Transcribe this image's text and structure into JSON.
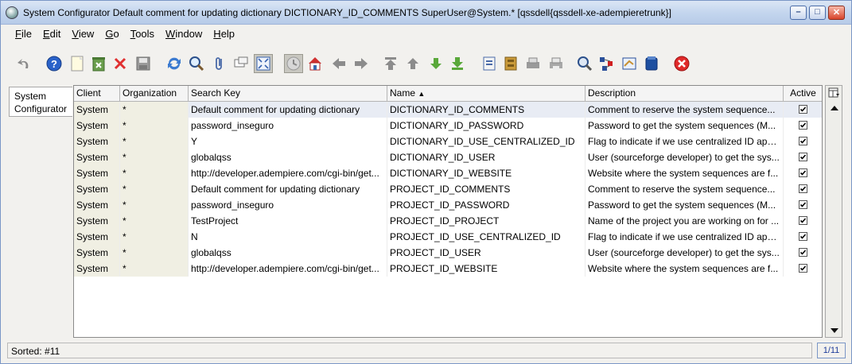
{
  "window": {
    "title": "System Configurator  Default comment for updating dictionary  DICTIONARY_ID_COMMENTS  SuperUser@System.* [qssdell{qssdell-xe-adempieretrunk}]",
    "min_glyph": "–",
    "max_glyph": "□",
    "close_glyph": "✕"
  },
  "menu": [
    {
      "pre": "",
      "u": "F",
      "post": "ile"
    },
    {
      "pre": "",
      "u": "E",
      "post": "dit"
    },
    {
      "pre": "",
      "u": "V",
      "post": "iew"
    },
    {
      "pre": "",
      "u": "G",
      "post": "o"
    },
    {
      "pre": "",
      "u": "T",
      "post": "ools"
    },
    {
      "pre": "",
      "u": "W",
      "post": "indow"
    },
    {
      "pre": "",
      "u": "H",
      "post": "elp"
    }
  ],
  "toolbar_icons": [
    "undo-icon",
    "help-icon",
    "new-record-icon",
    "delete-record-icon",
    "delete-icon",
    "save-icon",
    "refresh-icon",
    "find-icon",
    "attachment-icon",
    "chat-icon",
    "grid-toggle-icon",
    "history-icon",
    "home-icon",
    "previous-record-icon",
    "next-record-icon",
    "first-record-icon",
    "parent-record-icon",
    "detail-record-icon",
    "last-record-icon",
    "report-icon",
    "archive-icon",
    "print-icon",
    "print-preview-icon",
    "zoom-across-icon",
    "active-workflows-icon",
    "requests-icon",
    "product-info-icon",
    "exit-icon"
  ],
  "side_tab": {
    "line1": "System",
    "line2": "Configurator"
  },
  "grid": {
    "columns": [
      {
        "label": "Client"
      },
      {
        "label": "Organization"
      },
      {
        "label": "Search Key"
      },
      {
        "label": "Name",
        "sort": "▲"
      },
      {
        "label": "Description"
      },
      {
        "label": "Active"
      }
    ],
    "rows": [
      {
        "client": "System",
        "org": "*",
        "key": "Default comment for updating dictionary",
        "name": "DICTIONARY_ID_COMMENTS",
        "desc": "Comment to reserve the system sequence...",
        "active": true
      },
      {
        "client": "System",
        "org": "*",
        "key": "password_inseguro",
        "name": "DICTIONARY_ID_PASSWORD",
        "desc": "Password to get the system sequences (M...",
        "active": true
      },
      {
        "client": "System",
        "org": "*",
        "key": "Y",
        "name": "DICTIONARY_ID_USE_CENTRALIZED_ID",
        "desc": "Flag to indicate if we use centralized ID app...",
        "active": true
      },
      {
        "client": "System",
        "org": "*",
        "key": "globalqss",
        "name": "DICTIONARY_ID_USER",
        "desc": "User (sourceforge developer) to get the sys...",
        "active": true
      },
      {
        "client": "System",
        "org": "*",
        "key": "http://developer.adempiere.com/cgi-bin/get...",
        "name": "DICTIONARY_ID_WEBSITE",
        "desc": "Website where the system sequences are f...",
        "active": true
      },
      {
        "client": "System",
        "org": "*",
        "key": "Default comment for updating dictionary",
        "name": "PROJECT_ID_COMMENTS",
        "desc": "Comment to reserve the system sequence...",
        "active": true
      },
      {
        "client": "System",
        "org": "*",
        "key": "password_inseguro",
        "name": "PROJECT_ID_PASSWORD",
        "desc": "Password to get the system sequences (M...",
        "active": true
      },
      {
        "client": "System",
        "org": "*",
        "key": "TestProject",
        "name": "PROJECT_ID_PROJECT",
        "desc": "Name of the project you are working on for ...",
        "active": true
      },
      {
        "client": "System",
        "org": "*",
        "key": "N",
        "name": "PROJECT_ID_USE_CENTRALIZED_ID",
        "desc": "Flag to indicate if we use centralized ID app...",
        "active": true
      },
      {
        "client": "System",
        "org": "*",
        "key": "globalqss",
        "name": "PROJECT_ID_USER",
        "desc": "User (sourceforge developer) to get the sys...",
        "active": true
      },
      {
        "client": "System",
        "org": "*",
        "key": "http://developer.adempiere.com/cgi-bin/get...",
        "name": "PROJECT_ID_WEBSITE",
        "desc": "Website where the system sequences are f...",
        "active": true
      }
    ]
  },
  "status": {
    "text": "Sorted: #11",
    "pager": "1/11"
  }
}
